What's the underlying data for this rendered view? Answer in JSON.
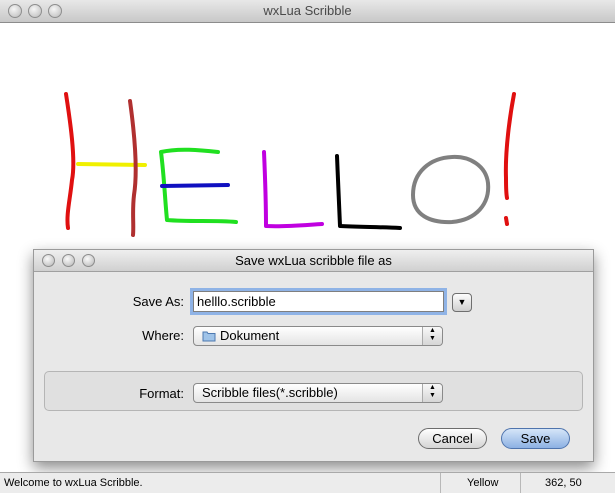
{
  "window": {
    "title": "wxLua Scribble"
  },
  "status": {
    "message": "Welcome to wxLua Scribble.",
    "color": "Yellow",
    "coords": "362, 50"
  },
  "dialog": {
    "title": "Save wxLua scribble file as",
    "save_as_label": "Save As:",
    "filename": "helllo.scribble",
    "where_label": "Where:",
    "where_value": "Dokument",
    "format_label": "Format:",
    "format_value": "Scribble files(*.scribble)",
    "cancel_label": "Cancel",
    "save_label": "Save"
  },
  "scribble_colors": {
    "red": "#e01010",
    "dark_red": "#b03030",
    "yellow": "#f0f000",
    "green": "#20e020",
    "blue": "#1010c0",
    "magenta": "#c000e0",
    "black": "#000000",
    "gray": "#808080"
  },
  "icons": [
    "folder-icon",
    "expand-arrow-icon",
    "popup-arrows-icon"
  ]
}
